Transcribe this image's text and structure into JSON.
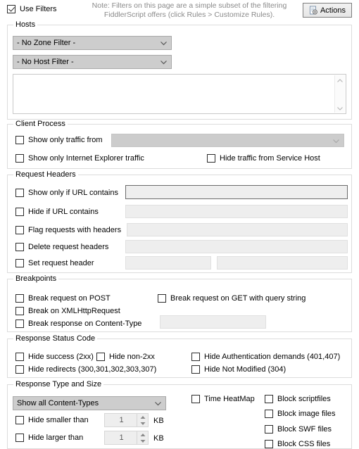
{
  "topbar": {
    "use_filters_label": "Use Filters",
    "use_filters_checked": true,
    "note_line1": "Note: Filters on this page are a simple subset of the filtering",
    "note_line2": "FiddlerScript offers (click Rules > Customize Rules).",
    "actions_label": "Actions"
  },
  "hosts": {
    "legend": "Hosts",
    "zone_filter_value": "- No Zone Filter -",
    "host_filter_value": "- No Host Filter -",
    "host_list_value": ""
  },
  "client_process": {
    "legend": "Client Process",
    "show_only_traffic_from_label": "Show only traffic from",
    "process_combo_value": "",
    "show_only_ie_label": "Show only Internet Explorer traffic",
    "hide_service_host_label": "Hide traffic from Service Host"
  },
  "request_headers": {
    "legend": "Request Headers",
    "show_only_if_url_label": "Show only if URL contains",
    "show_only_if_url_value": "",
    "hide_if_url_label": "Hide if URL contains",
    "hide_if_url_value": "",
    "flag_requests_label": "Flag requests with headers",
    "flag_requests_value": "",
    "delete_headers_label": "Delete request headers",
    "delete_headers_value": "",
    "set_header_label": "Set request header",
    "set_header_name_value": "",
    "set_header_value_value": ""
  },
  "breakpoints": {
    "legend": "Breakpoints",
    "break_post_label": "Break request on POST",
    "break_get_label": "Break request on GET with query string",
    "break_xhr_label": "Break on XMLHttpRequest",
    "break_response_label": "Break response on Content-Type",
    "break_response_value": ""
  },
  "response_status": {
    "legend": "Response Status Code",
    "hide_success_label": "Hide success (2xx)",
    "hide_non2xx_label": "Hide non-2xx",
    "hide_auth_label": "Hide Authentication demands (401,407)",
    "hide_redirects_label": "Hide redirects (300,301,302,303,307)",
    "hide_not_modified_label": "Hide Not Modified (304)"
  },
  "response_type": {
    "legend": "Response Type and Size",
    "content_types_value": "Show all Content-Types",
    "hide_smaller_label": "Hide smaller than",
    "hide_smaller_value": "1",
    "hide_smaller_unit": "KB",
    "hide_larger_label": "Hide larger than",
    "hide_larger_value": "1",
    "hide_larger_unit": "KB",
    "time_heatmap_label": "Time HeatMap",
    "block_script_label": "Block scriptfiles",
    "block_image_label": "Block image files",
    "block_swf_label": "Block SWF files",
    "block_css_label": "Block CSS files"
  },
  "colors": {
    "background": "#ffffff",
    "group_border": "#dcdcdc",
    "note_text": "#8a8a8a",
    "combo_fill": "#cdcdcd",
    "textbox_fill": "#eeeeee"
  }
}
